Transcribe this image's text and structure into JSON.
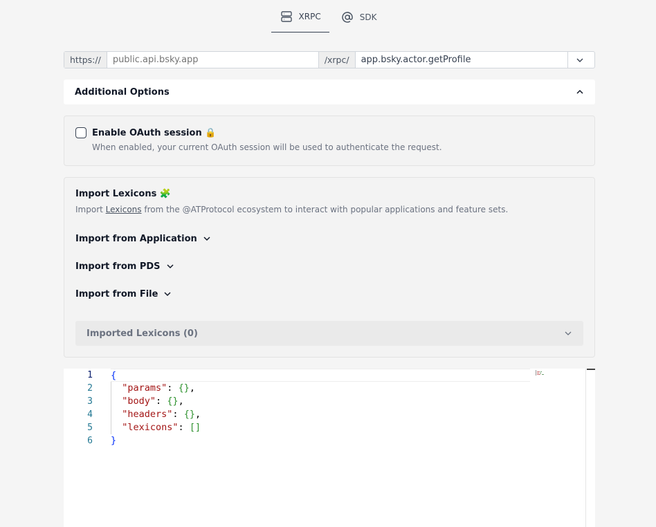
{
  "tabs": [
    {
      "label": "XRPC",
      "icon": "server-icon",
      "active": true
    },
    {
      "label": "SDK",
      "icon": "at-sign-icon",
      "active": false
    }
  ],
  "url": {
    "scheme_prefix": "https://",
    "host_placeholder": "public.api.bsky.app",
    "path_prefix": "/xrpc/",
    "method_value": "app.bsky.actor.getProfile",
    "dropdown_icon": "chevron-down-icon"
  },
  "additional_options": {
    "title": "Additional Options",
    "icon": "chevron-up-icon"
  },
  "oauth": {
    "label": "Enable OAuth session 🔒",
    "description": "When enabled, your current OAuth session will be used to authenticate the request.",
    "checked": false
  },
  "lexicons": {
    "title": "Import Lexicons 🧩",
    "desc_before": "Import ",
    "desc_link": "Lexicons",
    "desc_after": " from the @ATProtocol ecosystem to interact with popular applications and feature sets.",
    "import_app": "Import from Application",
    "import_pds": "Import from PDS",
    "import_file": "Import from File",
    "imported_label": "Imported Lexicons (0)"
  },
  "editor": {
    "line_numbers": [
      "1",
      "2",
      "3",
      "4",
      "5",
      "6"
    ],
    "open_brace": "{",
    "close_brace": "}",
    "lines": [
      {
        "key": "\"params\"",
        "value": "{}",
        "trail": ","
      },
      {
        "key": "\"body\"",
        "value": "{}",
        "trail": ","
      },
      {
        "key": "\"headers\"",
        "value": "{}",
        "trail": ","
      },
      {
        "key": "\"lexicons\"",
        "value": "[]",
        "trail": ""
      }
    ]
  }
}
